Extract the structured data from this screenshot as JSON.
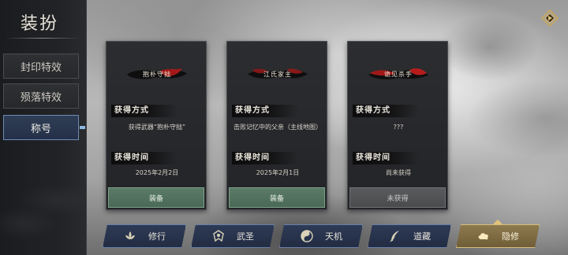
{
  "page": {
    "title": "装扮"
  },
  "sidebar": {
    "tabs": [
      {
        "label": "封印特效",
        "active": false
      },
      {
        "label": "殒落特效",
        "active": false
      },
      {
        "label": "称号",
        "active": true
      }
    ]
  },
  "corner": {
    "icon": "diamond-menu-icon"
  },
  "cards": [
    {
      "banner": "抱朴守拙",
      "acquire_label": "获得方式",
      "acquire_text": "获得武器“抱朴守拙”",
      "time_label": "获得时间",
      "time_value": "2025年2月2日",
      "button": "装备",
      "state": "equip"
    },
    {
      "banner": "江氏家主",
      "acquire_label": "获得方式",
      "acquire_text": "击败记忆中的父亲（主线地图）",
      "time_label": "获得时间",
      "time_value": "2025年2月1日",
      "button": "装备",
      "state": "equip"
    },
    {
      "banner": "诡见杀手",
      "acquire_label": "获得方式",
      "acquire_text": "???",
      "time_label": "获得时间",
      "time_value": "尚未获得",
      "button": "未获得",
      "state": "locked"
    }
  ],
  "bottom_nav": [
    {
      "label": "修行",
      "icon": "lotus-icon",
      "active": false
    },
    {
      "label": "武圣",
      "icon": "crest-icon",
      "active": false
    },
    {
      "label": "天机",
      "icon": "yinyang-icon",
      "active": false
    },
    {
      "label": "道藏",
      "icon": "feather-icon",
      "active": false
    },
    {
      "label": "隐修",
      "icon": "cloud-icon",
      "active": true
    }
  ],
  "colors": {
    "accent_blue": "#6f8bb5",
    "equip_green": "#5b7b67",
    "active_gold": "#d7bd7e",
    "banner_red": "#b21a1a"
  }
}
